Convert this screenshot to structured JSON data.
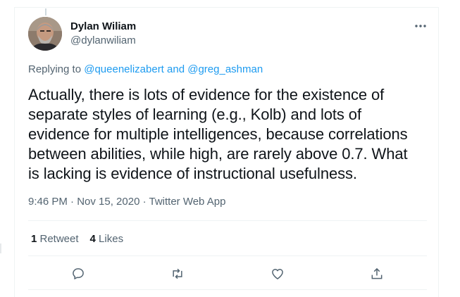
{
  "author": {
    "display_name": "Dylan Wiliam",
    "handle": "@dylanwiliam"
  },
  "reply": {
    "prefix": "Replying to ",
    "user1": "@queenelizabert",
    "conjunction": " and ",
    "user2": "@greg_ashman"
  },
  "tweet": {
    "lines": [
      "Actually, there is lots of evidence for the existence of",
      "separate styles of learning (e.g., Kolb) and lots of",
      "evidence for multiple intelligences, because correlations",
      "between abilities, while high, are rarely above 0.7. What",
      "is lacking is evidence of instructional usefulness."
    ]
  },
  "meta": {
    "text": "9:46 PM · Nov 15, 2020 · Twitter Web App"
  },
  "stats": {
    "retweets_count": "1",
    "retweets_label": " Retweet",
    "likes_count": "4",
    "likes_label": " Likes"
  },
  "icons": {
    "more": "more-horizontal-icon",
    "reply": "reply-bubble-icon",
    "retweet": "retweet-icon",
    "like": "heart-icon",
    "share": "share-upload-icon"
  },
  "colors": {
    "link": "#1d9bf0",
    "secondary_text": "#536471",
    "primary_text": "#0f1419",
    "divider": "#eff3f4"
  }
}
